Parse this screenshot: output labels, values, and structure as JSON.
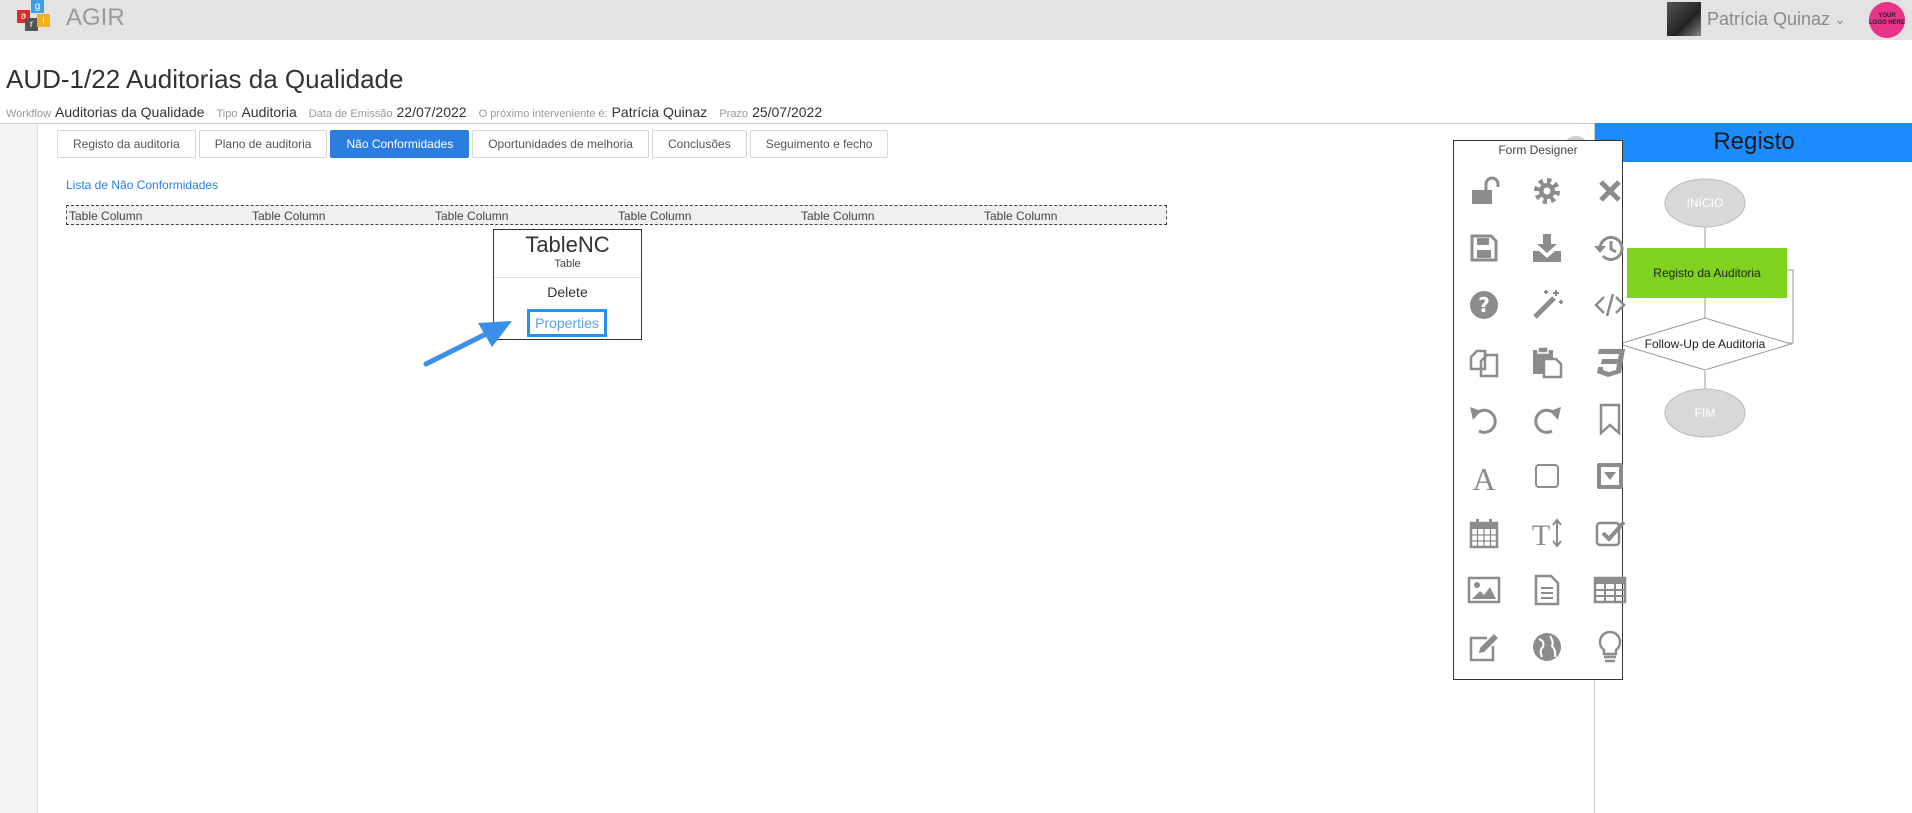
{
  "app": {
    "name": "AGIR",
    "logo_letters": [
      "a",
      "g",
      "r",
      "i"
    ]
  },
  "user": {
    "name": "Patrícia Quinaz",
    "brand_logo_text": "YOUR LOGO HERE"
  },
  "header": {
    "title": "AUD-1/22 Auditorias da Qualidade"
  },
  "meta": [
    {
      "label": "Workflow",
      "value": "Auditorias da Qualidade"
    },
    {
      "label": "Tipo",
      "value": "Auditoria"
    },
    {
      "label": "Data de Emissão",
      "value": "22/07/2022"
    },
    {
      "label": "O próximo interveniente é:",
      "value": "Patrícia Quinaz"
    },
    {
      "label": "Prazo",
      "value": "25/07/2022"
    }
  ],
  "tabs": [
    {
      "label": "Registo da auditoria"
    },
    {
      "label": "Plano de auditoria"
    },
    {
      "label": "Não Conformidades",
      "active": true
    },
    {
      "label": "Oportunidades de melhoria"
    },
    {
      "label": "Conclusões"
    },
    {
      "label": "Seguimento e fecho"
    }
  ],
  "list": {
    "title": "Lista de Não Conformidades",
    "columns": [
      "Table Column",
      "Table Column",
      "Table Column",
      "Table Column",
      "Table Column",
      "Table Column"
    ]
  },
  "context_menu": {
    "title": "TableNC",
    "subtitle": "Table",
    "delete_label": "Delete",
    "properties_label": "Properties"
  },
  "form_designer": {
    "title": "Form Designer",
    "tools": [
      "unlock-icon",
      "gear-icon",
      "close-icon",
      "save-icon",
      "download-icon",
      "history-icon",
      "help-icon",
      "magic-wand-icon",
      "code-icon",
      "copy-icon",
      "paste-icon",
      "css3-icon",
      "undo-icon",
      "redo-icon",
      "bookmark-icon",
      "text-icon",
      "square-icon",
      "dropdown-icon",
      "calendar-icon",
      "text-height-icon",
      "checkbox-icon",
      "image-icon",
      "document-icon",
      "table-icon",
      "edit-icon",
      "globe-icon",
      "lightbulb-icon"
    ]
  },
  "workflow": {
    "panel_title": "Registo",
    "nodes": {
      "start": "INÍCIO",
      "register": "Registo da Auditoria",
      "followup": "Follow-Up de Auditoria",
      "end": "FIM"
    },
    "colors": {
      "active": "#7ed321",
      "header": "#1a8cff",
      "terminal": "#d8d8d8"
    }
  },
  "colors": {
    "accent": "#2b7ee0",
    "icon": "#8c8c8c"
  }
}
